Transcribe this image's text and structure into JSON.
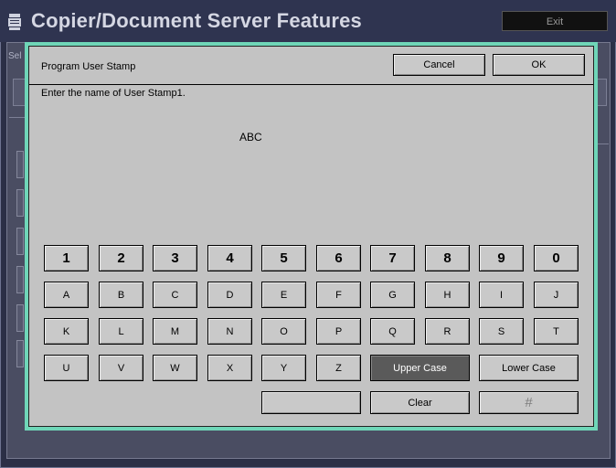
{
  "app": {
    "title": "Copier/Document Server Features",
    "exit_label": "Exit",
    "background_left_label": "Sel",
    "background_right_label": "s"
  },
  "dialog": {
    "header": "Program User Stamp",
    "cancel_label": "Cancel",
    "ok_label": "OK",
    "prompt": "Enter the name of User Stamp1.",
    "value": "ABC"
  },
  "keyboard": {
    "row_numbers": [
      "1",
      "2",
      "3",
      "4",
      "5",
      "6",
      "7",
      "8",
      "9",
      "0"
    ],
    "row1": [
      "A",
      "B",
      "C",
      "D",
      "E",
      "F",
      "G",
      "H",
      "I",
      "J"
    ],
    "row2": [
      "K",
      "L",
      "M",
      "N",
      "O",
      "P",
      "Q",
      "R",
      "S",
      "T"
    ],
    "row3": [
      "U",
      "V",
      "W",
      "X",
      "Y",
      "Z"
    ],
    "upper_case_label": "Upper Case",
    "lower_case_label": "Lower Case",
    "space_label": "",
    "clear_label": "Clear",
    "hash_label": "#"
  },
  "colors": {
    "dialog_border": "#6fd6b8",
    "dialog_background": "#c3c3c3",
    "selected_key": "#5a5a5a"
  }
}
